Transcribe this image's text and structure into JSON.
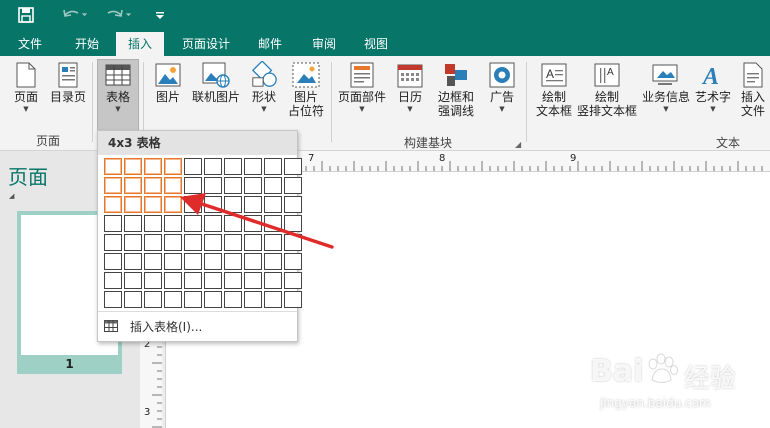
{
  "qat": {
    "save_icon": "save-icon",
    "undo_icon": "undo-icon",
    "redo_icon": "redo-icon",
    "customize_icon": "customize-qat-icon"
  },
  "tabs": [
    "文件",
    "开始",
    "插入",
    "页面设计",
    "邮件",
    "审阅",
    "视图"
  ],
  "active_tab": "插入",
  "ribbon": {
    "pages_group": {
      "label": "页面",
      "cover_page": "页面",
      "catalog_page": "目录页"
    },
    "table": {
      "label": "表格"
    },
    "illustrations": {
      "picture": "图片",
      "online_picture": "联机图片",
      "shapes": "形状",
      "placeholder_line1": "图片",
      "placeholder_line2": "占位符"
    },
    "building_blocks": {
      "label": "构建基块",
      "page_parts": "页面部件",
      "calendar": "日历",
      "borders_line1": "边框和",
      "borders_line2": "强调线",
      "ad": "广告"
    },
    "text": {
      "label": "文本",
      "draw_textbox_line1": "绘制",
      "draw_textbox_line2": "文本框",
      "vertical_textbox_line1": "绘制",
      "vertical_textbox_line2": "竖排文本框",
      "business_info": "业务信息",
      "wordart": "艺术字",
      "insert_file_line1": "插入",
      "insert_file_line2": "文件"
    }
  },
  "table_dropdown": {
    "header": "4x3 表格",
    "columns": 10,
    "rows": 8,
    "selected_columns": 4,
    "selected_rows": 3,
    "insert_table_label": "插入表格(I)...",
    "selected_color": "#e8772e"
  },
  "pages_panel": {
    "title": "页面",
    "page_number": "1"
  },
  "ruler_h_labels": [
    "7",
    "8",
    "9"
  ],
  "ruler_v_labels": [
    "2",
    "3"
  ],
  "watermark": {
    "brand_text": "Bai",
    "brand_suffix": "经验",
    "url": "jingyan.baidu.com"
  },
  "colors": {
    "accent": "#077568",
    "selection": "#e8772e",
    "arrow": "#e02b2b"
  }
}
